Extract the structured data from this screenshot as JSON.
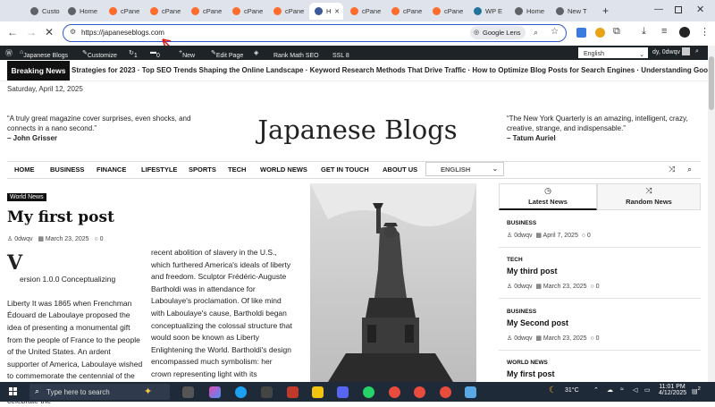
{
  "browser": {
    "tabs": [
      {
        "label": "Custo",
        "color": "#5f6368"
      },
      {
        "label": "Home",
        "color": "#5f6368"
      },
      {
        "label": "cPane",
        "color": "#ff6c2c"
      },
      {
        "label": "cPane",
        "color": "#ff6c2c"
      },
      {
        "label": "cPane",
        "color": "#ff6c2c"
      },
      {
        "label": "cPane",
        "color": "#ff6c2c"
      },
      {
        "label": "cPane",
        "color": "#ff6c2c"
      },
      {
        "label": "H",
        "color": "#3b5998"
      },
      {
        "label": "cPane",
        "color": "#ff6c2c"
      },
      {
        "label": "cPane",
        "color": "#ff6c2c"
      },
      {
        "label": "cPane",
        "color": "#ff6c2c"
      },
      {
        "label": "WP E",
        "color": "#21759b"
      },
      {
        "label": "Home",
        "color": "#5f6368"
      },
      {
        "label": "New T",
        "color": "#5f6368"
      }
    ],
    "url": "https://japaneseblogs.com",
    "lens_label": "Google Lens"
  },
  "wpadmin": {
    "site_name": "Japanese Blogs",
    "customize": "Customize",
    "updates": "1",
    "comments": "0",
    "new": "New",
    "edit_page": "Edit Page",
    "seo": "Rank Math SEO",
    "ssl": "SSL 8",
    "language": "English",
    "howdy": "dy, 0dwqv"
  },
  "ticker": {
    "label": "Breaking News",
    "text": "Strategies for 2023  ·  Top SEO Trends Shaping the Online Landscape  ·  Keyword Research Methods That Drive Traffic  ·  How to Optimize Blog Posts for Search Engines  ·  Understanding Google"
  },
  "date": "Saturday, April 12, 2025",
  "header": {
    "quote_left": "“A truly great magazine cover surprises, even shocks, and connects in a nano second.”",
    "author_left": "– John Grisser",
    "title": "Japanese Blogs",
    "quote_right": "“The New York Quarterly is an amazing, intelligent, crazy, creative, strange, and indispensable.”",
    "author_right": "– Tatum Auriel"
  },
  "nav": {
    "items": [
      "HOME",
      "BUSINESS",
      "FINANCE",
      "LIFESTYLE",
      "SPORTS",
      "TECH",
      "WORLD NEWS",
      "GET IN TOUCH",
      "ABOUT US"
    ],
    "language": "ENGLISH"
  },
  "post": {
    "category": "World News",
    "title": "My first post",
    "author": "0dwqv",
    "date": "March 23, 2025",
    "comments": "0",
    "dropcap": "V",
    "col1": "ersion 1.0.0 Conceptualizing\n\nLiberty It was 1865 when Frenchman Édouard de Laboulaye proposed the idea of presenting a monumental gift from the people of France to the people of the United States. An ardent supporter of America, Laboulaye wished to commemorate the centennial of the Declaration of Independence as well as celebrate the",
    "col2": "recent abolition of slavery in the U.S., which furthered America's ideals of liberty and freedom. Sculptor Frédéric-Auguste Bartholdi was in attendance for Laboulaye's proclamation. Of like mind with Laboulaye's cause, Bartholdi began conceptualizing the colossal structure that would soon be known as Liberty Enlightening the World. Bartholdi's design encompassed much symbolism: her crown representing light with its"
  },
  "sidebar": {
    "tab_latest": "Latest News",
    "tab_random": "Random News",
    "items": [
      {
        "category": "BUSINESS",
        "title": "",
        "author": "0dwqv",
        "date": "April 7, 2025",
        "comments": "0"
      },
      {
        "category": "TECH",
        "title": "My third post",
        "author": "0dwqv",
        "date": "March 23, 2025",
        "comments": "0"
      },
      {
        "category": "BUSINESS",
        "title": "My Second post",
        "author": "0dwqv",
        "date": "March 23, 2025",
        "comments": "0"
      },
      {
        "category": "WORLD NEWS",
        "title": "My first post",
        "author": "",
        "date": "",
        "comments": ""
      }
    ]
  },
  "taskbar": {
    "search_placeholder": "Type here to search",
    "weather": "31°C",
    "time": "11:01 PM",
    "date": "4/12/2025",
    "notif": "2"
  }
}
